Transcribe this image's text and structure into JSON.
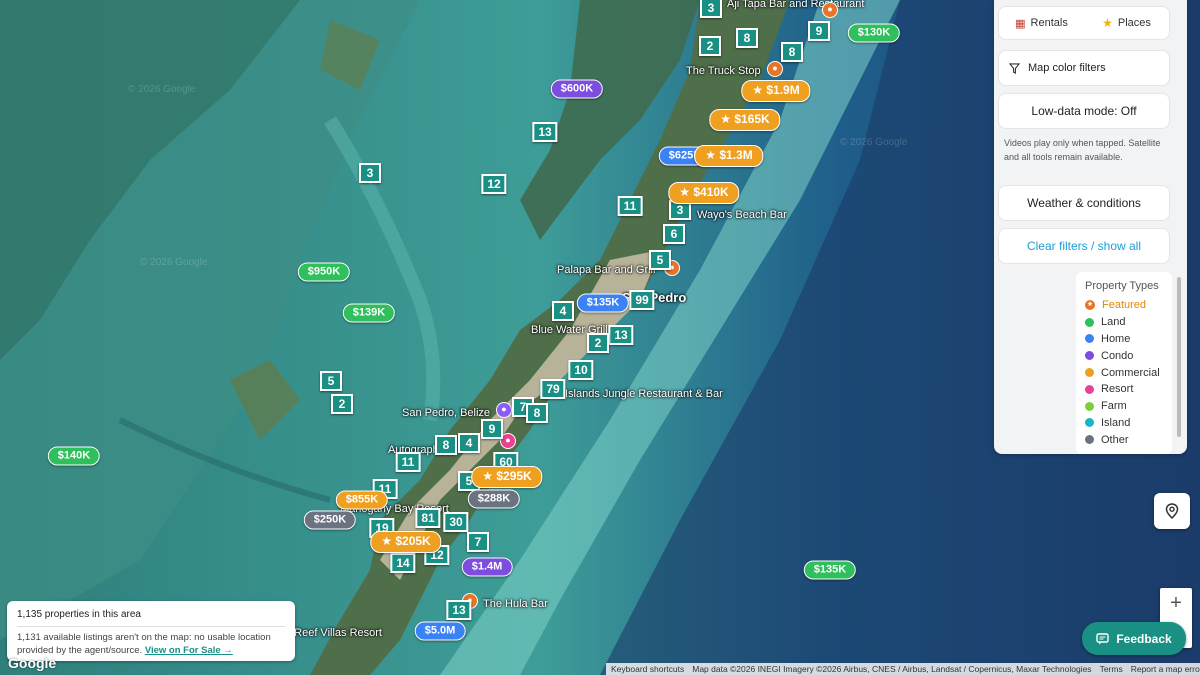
{
  "panel": {
    "tabs": [
      {
        "label": "Rentals",
        "icon": "building-icon"
      },
      {
        "label": "Places",
        "icon": "star-icon"
      }
    ],
    "map_color_filters": "Map color filters",
    "low_data_mode": "Low-data mode: Off",
    "low_data_note": "Videos play only when tapped. Satellite and all tools remain available.",
    "weather": "Weather & conditions",
    "clear_filters": "Clear filters / show all",
    "legend": {
      "title": "Property Types",
      "items": [
        {
          "label": "Featured",
          "color": "#f0a020"
        },
        {
          "label": "Land",
          "color": "#2fbf5c"
        },
        {
          "label": "Home",
          "color": "#3b82f6"
        },
        {
          "label": "Condo",
          "color": "#7c4dde"
        },
        {
          "label": "Commercial",
          "color": "#f0a020"
        },
        {
          "label": "Resort",
          "color": "#e84393"
        },
        {
          "label": "Farm",
          "color": "#7ad03a"
        },
        {
          "label": "Island",
          "color": "#17b6c9"
        },
        {
          "label": "Other",
          "color": "#6b7280"
        }
      ]
    }
  },
  "info": {
    "count": "1,135 properties in this area",
    "note": "1,131 available listings aren't on the map: no usable location provided by the agent/source.",
    "link": "View on For Sale →"
  },
  "feedback": "Feedback",
  "zoom": {
    "in": "+",
    "out": "−"
  },
  "google": "Google",
  "attribution": [
    "Keyboard shortcuts",
    "Map data ©2026 INEGI Imagery ©2026 Airbus, CNES / Airbus, Landsat / Copernicus, Maxar Technologies",
    "Terms",
    "Report a map error"
  ],
  "places": [
    "Aji Tapa Bar and Restaurant",
    "The Truck Stop",
    "Wayo's Beach Bar",
    "Palapa Bar and Grill",
    "San Pedro",
    "Blue Water Grill",
    "Islands Jungle Restaurant & Bar",
    "San Pedro, Belize",
    "Autograph",
    "Mahogany Bay Resort",
    "The Hula Bar",
    "Belican Reef Villas Resort"
  ],
  "clusters": [
    "3",
    "8",
    "9",
    "2",
    "8",
    "13",
    "3",
    "12",
    "11",
    "3",
    "6",
    "5",
    "99",
    "4",
    "13",
    "2",
    "10",
    "79",
    "7",
    "8",
    "9",
    "8",
    "4",
    "60",
    "11",
    "5",
    "11",
    "19",
    "81",
    "30",
    "7",
    "12",
    "14",
    "13",
    "5",
    "2"
  ],
  "prices": [
    {
      "label": "$130K",
      "type": "land"
    },
    {
      "label": "$600K",
      "type": "condo"
    },
    {
      "label": "★ $1.9M",
      "type": "featured"
    },
    {
      "label": "★ $165K",
      "type": "featured"
    },
    {
      "label": "$625K",
      "type": "home"
    },
    {
      "label": "★ $1.3M",
      "type": "featured"
    },
    {
      "label": "★ $410K",
      "type": "featured"
    },
    {
      "label": "$950K",
      "type": "land"
    },
    {
      "label": "$139K",
      "type": "land"
    },
    {
      "label": "$135K",
      "type": "home"
    },
    {
      "label": "$140K",
      "type": "land"
    },
    {
      "label": "★ $295K",
      "type": "featured"
    },
    {
      "label": "$288K",
      "type": "other"
    },
    {
      "label": "$855K",
      "type": "commercial"
    },
    {
      "label": "$250K",
      "type": "other"
    },
    {
      "label": "★ $205K",
      "type": "featured"
    },
    {
      "label": "$1.4M",
      "type": "condo"
    },
    {
      "label": "$5.0M",
      "type": "home"
    },
    {
      "label": "$135K",
      "type": "land"
    }
  ]
}
